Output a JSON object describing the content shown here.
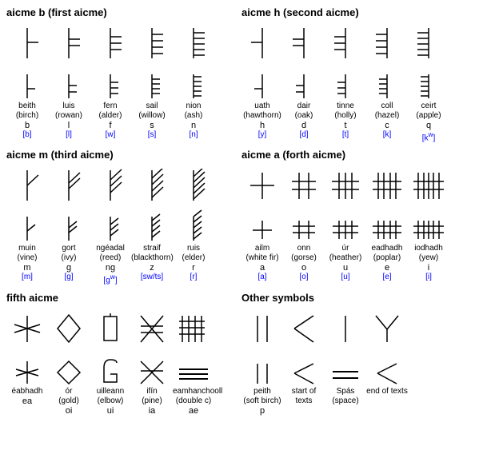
{
  "sections": {
    "aicme_b": {
      "title": "aicme b (first aicme)",
      "characters": [
        {
          "name": "beith",
          "sub": "(birch)",
          "latin": "b",
          "ipa": "[b]"
        },
        {
          "name": "luis",
          "sub": "(rowan)",
          "latin": "l",
          "ipa": "[l]"
        },
        {
          "name": "fern",
          "sub": "(alder)",
          "latin": "f",
          "ipa": "[w]"
        },
        {
          "name": "sail",
          "sub": "(willow)",
          "latin": "s",
          "ipa": "[s]"
        },
        {
          "name": "nion",
          "sub": "(ash)",
          "latin": "n",
          "ipa": "[n]"
        }
      ]
    },
    "aicme_h": {
      "title": "aicme h (second aicme)",
      "characters": [
        {
          "name": "uath",
          "sub": "(hawthorn)",
          "latin": "h",
          "ipa": "[y]"
        },
        {
          "name": "dair",
          "sub": "(oak)",
          "latin": "d",
          "ipa": "[d]"
        },
        {
          "name": "tinne",
          "sub": "(holly)",
          "latin": "t",
          "ipa": "[t]"
        },
        {
          "name": "coll",
          "sub": "(hazel)",
          "latin": "c",
          "ipa": "[k]"
        },
        {
          "name": "ceirt",
          "sub": "(apple)",
          "latin": "q",
          "ipa": "[kw]"
        }
      ]
    },
    "aicme_m": {
      "title": "aicme m (third aicme)",
      "characters": [
        {
          "name": "muin",
          "sub": "(vine)",
          "latin": "m",
          "ipa": "[m]"
        },
        {
          "name": "gort",
          "sub": "(ivy)",
          "latin": "g",
          "ipa": "[g]"
        },
        {
          "name": "ngéadal",
          "sub": "(reed)",
          "latin": "ng",
          "ipa": "[gw]"
        },
        {
          "name": "straif",
          "sub": "(blackthorn)",
          "latin": "z",
          "ipa": "[sw/ts]"
        },
        {
          "name": "ruis",
          "sub": "(elder)",
          "latin": "r",
          "ipa": "[r]"
        }
      ]
    },
    "aicme_a": {
      "title": "aicme a (forth aicme)",
      "characters": [
        {
          "name": "ailm",
          "sub": "(white fir)",
          "latin": "a",
          "ipa": "[a]"
        },
        {
          "name": "onn",
          "sub": "(gorse)",
          "latin": "o",
          "ipa": "[o]"
        },
        {
          "name": "úr",
          "sub": "(heather)",
          "latin": "u",
          "ipa": "[u]"
        },
        {
          "name": "eadhadh",
          "sub": "(poplar)",
          "latin": "e",
          "ipa": "[e]"
        },
        {
          "name": "iodhadh",
          "sub": "(yew)",
          "latin": "i",
          "ipa": "[i]"
        }
      ]
    },
    "fifth_aicme": {
      "title": "fifth aicme",
      "characters": [
        {
          "name": "éabhadh",
          "sub": "",
          "latin": "ea",
          "ipa": ""
        },
        {
          "name": "ór",
          "sub": "(gold)",
          "latin": "oi",
          "ipa": ""
        },
        {
          "name": "uilleann",
          "sub": "(elbow)",
          "latin": "ui",
          "ipa": ""
        },
        {
          "name": "ifín",
          "sub": "(pine)",
          "latin": "ia",
          "ipa": ""
        },
        {
          "name": "eamhanchooll",
          "sub": "(double c)",
          "latin": "ae",
          "ipa": ""
        }
      ]
    },
    "other_symbols": {
      "title": "Other symbols",
      "characters": [
        {
          "name": "peith",
          "sub": "(soft birch)",
          "latin": "p",
          "ipa": ""
        },
        {
          "name": "start of texts",
          "sub": "",
          "latin": "",
          "ipa": ""
        },
        {
          "name": "Spás",
          "sub": "(space)",
          "latin": "",
          "ipa": ""
        },
        {
          "name": "end of texts",
          "sub": "",
          "latin": "",
          "ipa": ""
        }
      ]
    }
  }
}
